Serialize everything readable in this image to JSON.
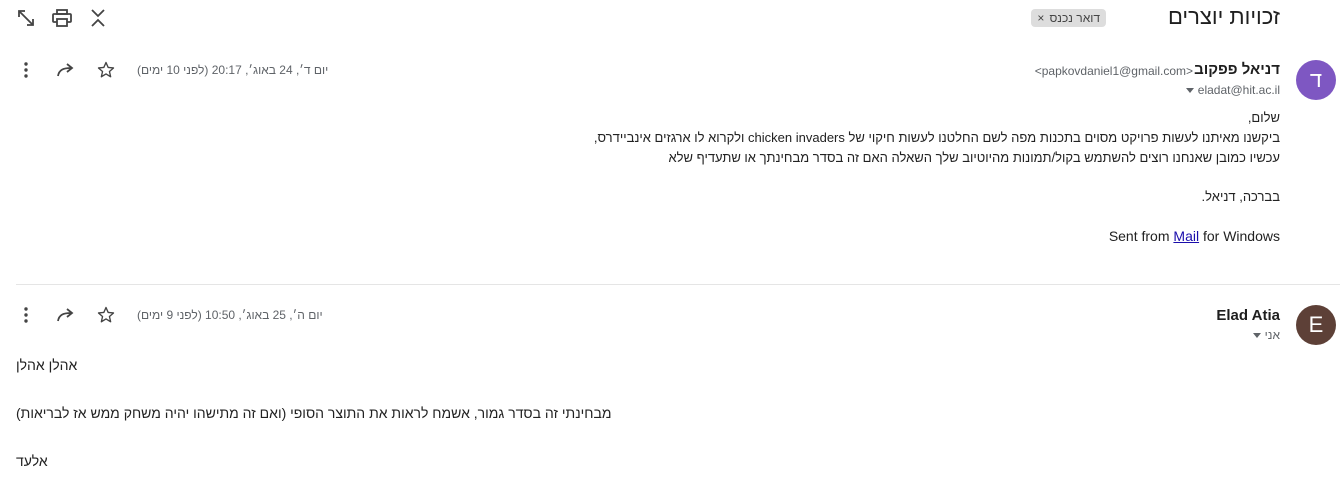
{
  "thread": {
    "subject": "זכויות יוצרים",
    "label": "דואר נכנס",
    "label_remove": "×"
  },
  "toolbar": {
    "icons": [
      "open-in-new-window-icon",
      "print-icon",
      "collapse-all-icon"
    ]
  },
  "messages": [
    {
      "avatar_letter": "ד",
      "avatar_color": "#7e57c2",
      "sender_name": "דניאל פפקוב",
      "sender_email": "<papkovdaniel1@gmail.com>",
      "recipient": "eladat@hit.ac.il",
      "date": "יום ד׳, 24 באוג׳, 20:17 (לפני 10 ימים)",
      "body": {
        "greeting": "שלום,",
        "line1_prefix": "ביקשנו מאיתנו לעשות פרויקט מסוים בתכנות מפה לשם החלטנו לעשות חיקוי של ",
        "line1_english": "chicken invaders",
        "line1_suffix": " ולקרוא לו ארגזים אינביידרס,",
        "line2": "עכשיו כמובן שאנחנו רוצים להשתמש בקול/תמונות מהיוטיוב שלך השאלה האם זה בסדר מבחינתך או שתעדיף שלא",
        "signoff": "בברכה, דניאל.",
        "sent_prefix": "Sent from ",
        "sent_link": "Mail",
        "sent_suffix": " for Windows"
      }
    },
    {
      "avatar_letter": "E",
      "avatar_color": "#5d4037",
      "sender_name": "Elad Atia",
      "recipient": "אני",
      "date": "יום ה׳, 25 באוג׳, 10:50 (לפני 9 ימים)",
      "body": {
        "line1": "אהלן אהלן",
        "line2": "מבחינתי זה בסדר גמור, אשמח לראות את התוצר הסופי (ואם זה מתישהו יהיה משחק ממש אז לבריאות)",
        "line3": "אלעד"
      }
    }
  ]
}
